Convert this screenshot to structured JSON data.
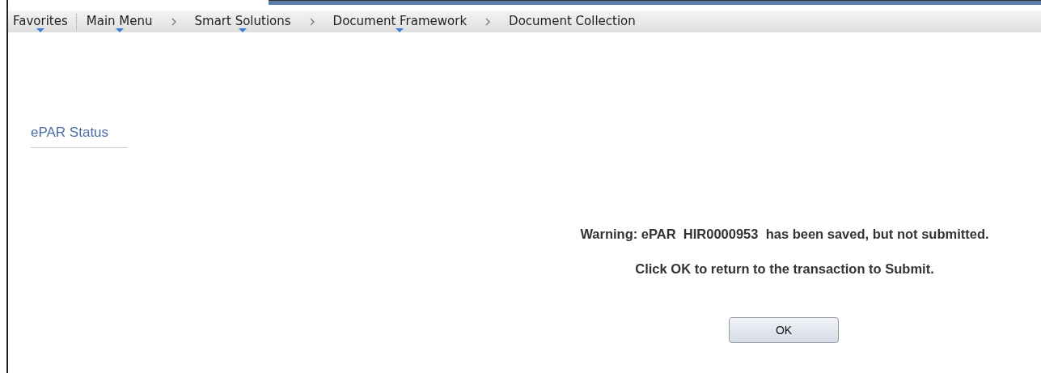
{
  "breadcrumb": [
    {
      "label": "Favorites",
      "has_menu": true
    },
    {
      "label": "Main Menu",
      "has_menu": true
    },
    {
      "label": "Smart Solutions",
      "has_menu": true
    },
    {
      "label": "Document Framework",
      "has_menu": true
    },
    {
      "label": "Document Collection",
      "has_menu": false
    }
  ],
  "page_title": "ePAR Status",
  "messages": [
    "Warning: ePAR  HIR0000953  has been saved, but not submitted.",
    "Click OK to return to the transaction to Submit."
  ],
  "buttons": [
    "OK"
  ]
}
